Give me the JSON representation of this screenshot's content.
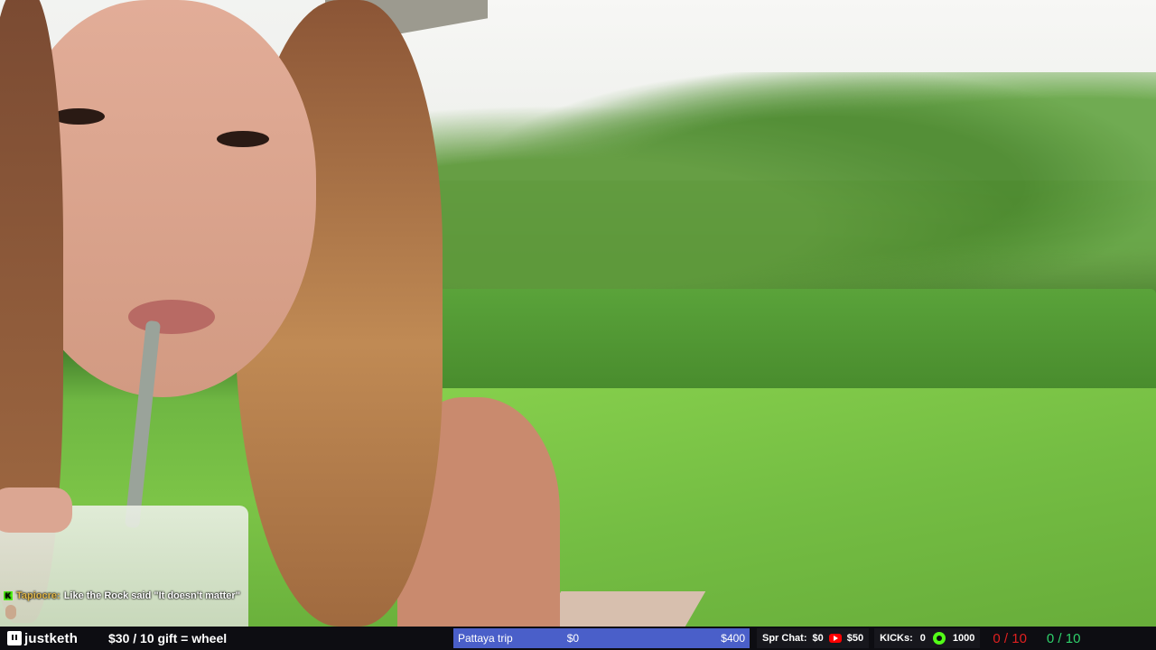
{
  "chat": {
    "username": "Tapiocre:",
    "message": "Like the Rock said \"It doesn't matter\"",
    "badge": "K"
  },
  "bottom_bar": {
    "channel_name": "justketh",
    "gift_text": "$30 / 10 gift = wheel",
    "goal": {
      "label": "Pattaya trip",
      "current": "$0",
      "target": "$400",
      "color": "#4a5fc9"
    },
    "spr_chat": {
      "label": "Spr Chat:",
      "value": "$0",
      "youtube_value": "$50"
    },
    "kicks": {
      "label": "KICKs:",
      "value": "0",
      "kick_goal": "1000"
    },
    "score_red": "0 / 10",
    "score_green": "0 / 10"
  },
  "colors": {
    "accent_red": "#e02020",
    "accent_green": "#2fd06a",
    "kick_green": "#53fc18"
  }
}
